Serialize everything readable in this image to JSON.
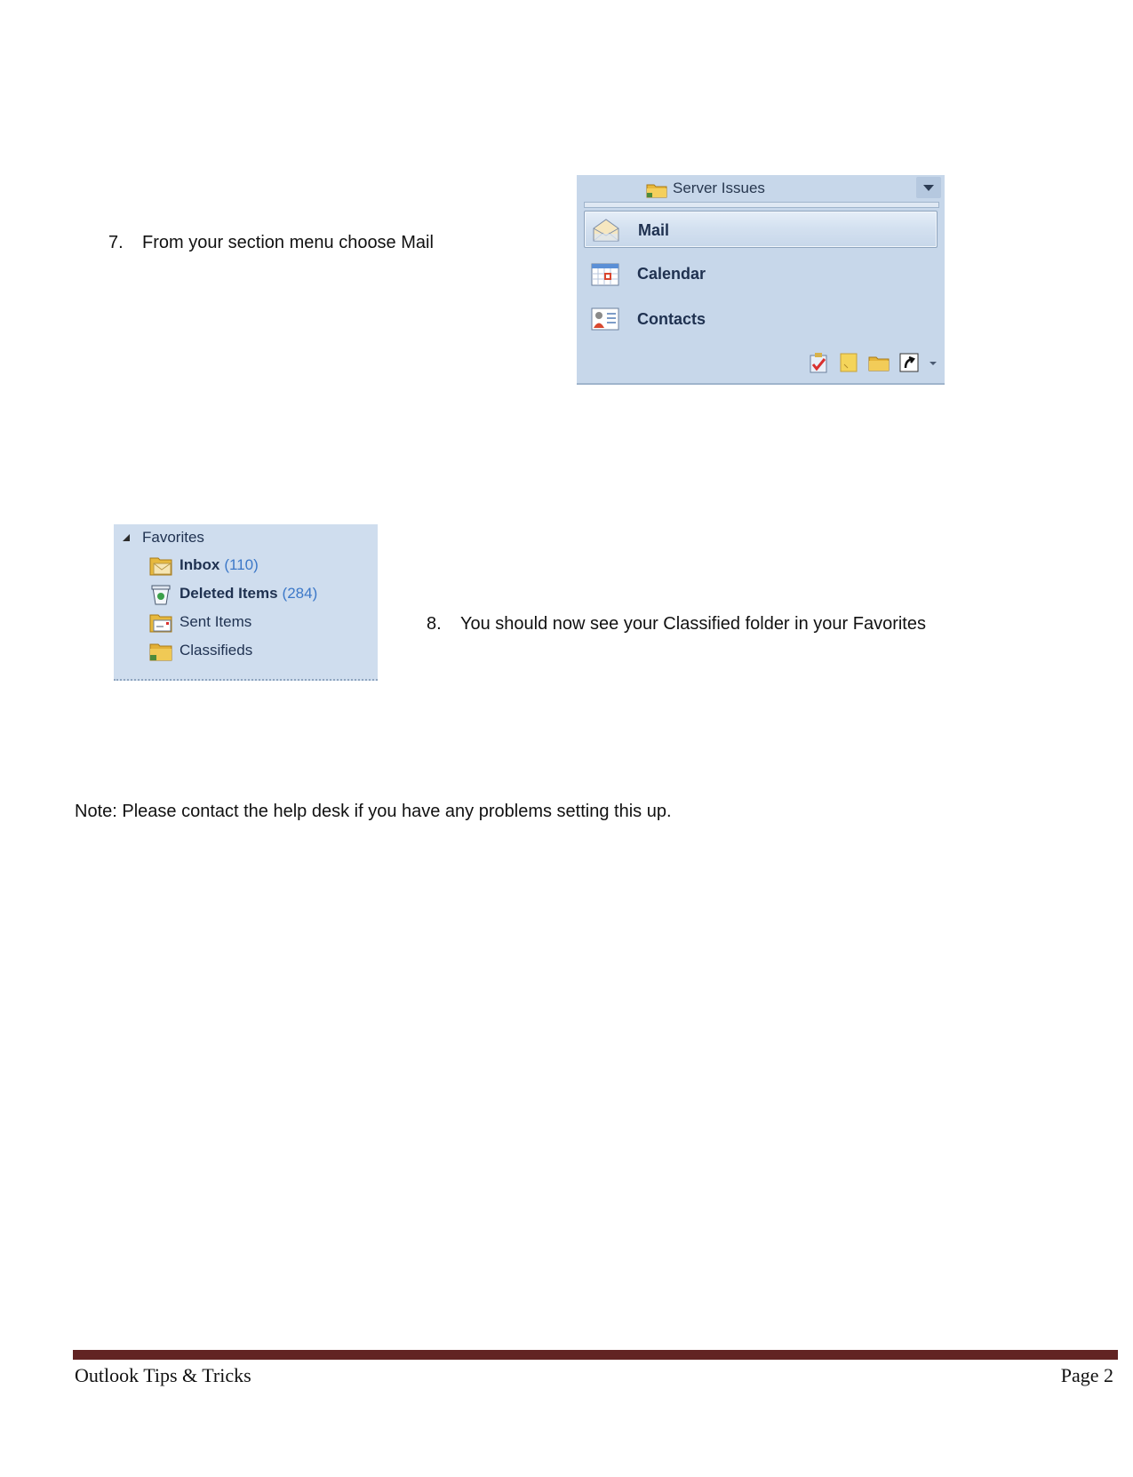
{
  "steps": [
    {
      "number": "7.",
      "text": "From your section menu choose Mail"
    },
    {
      "number": "8.",
      "text": "You should now see your Classified folder in your Favorites"
    }
  ],
  "note": "Note: Please contact the help desk if you have any problems setting this up.",
  "navigation_pane": {
    "header_folder": "Server Issues",
    "header_icon": "folder-icon",
    "items": [
      {
        "label": "Mail",
        "icon": "mail-envelope-icon",
        "selected": true
      },
      {
        "label": "Calendar",
        "icon": "calendar-icon",
        "selected": false
      },
      {
        "label": "Contacts",
        "icon": "contacts-card-icon",
        "selected": false
      }
    ],
    "toolbar": [
      "tasks-icon",
      "notes-icon",
      "folder-list-icon",
      "shortcuts-icon",
      "configure-buttons-chevron-icon"
    ]
  },
  "favorites_pane": {
    "header": "Favorites",
    "items": [
      {
        "label": "Inbox",
        "count": "(110)",
        "bold": true,
        "icon": "inbox-folder-icon"
      },
      {
        "label": "Deleted Items",
        "count": "(284)",
        "bold": true,
        "icon": "recycle-bin-icon"
      },
      {
        "label": "Sent Items",
        "count": "",
        "bold": false,
        "icon": "sent-items-folder-icon"
      },
      {
        "label": "Classifieds",
        "count": "",
        "bold": false,
        "icon": "shared-folder-icon"
      }
    ]
  },
  "footer": {
    "title": "Outlook Tips & Tricks",
    "page": "Page 2",
    "rule_color": "#622423"
  },
  "colors": {
    "pane_background": "#c7d7ea",
    "label_text": "#1f3150",
    "count_text": "#3c78c8"
  }
}
